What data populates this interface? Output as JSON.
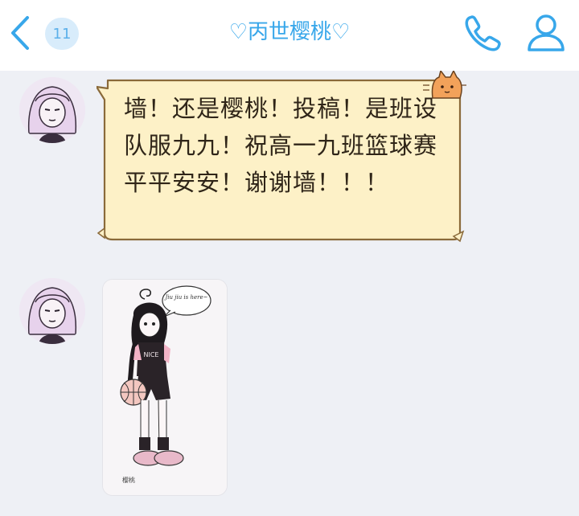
{
  "header": {
    "unread_count": "11",
    "title": "♡丙世樱桃♡"
  },
  "messages": [
    {
      "type": "text",
      "text": "墙！还是樱桃！投稿！是班设队服九九！祝高一九班篮球赛平平安安！谢谢墙！！！"
    },
    {
      "type": "image",
      "speech_text": "Jiu jiu is here~",
      "signature": "樱桃"
    }
  ],
  "colors": {
    "accent": "#38a7ea",
    "bubble_fill": "#fdf1c7",
    "bubble_border": "#8a6a3a",
    "background": "#eef0f5"
  },
  "icons": [
    "back-arrow-icon",
    "phone-icon",
    "person-icon",
    "cat-decoration-icon"
  ]
}
